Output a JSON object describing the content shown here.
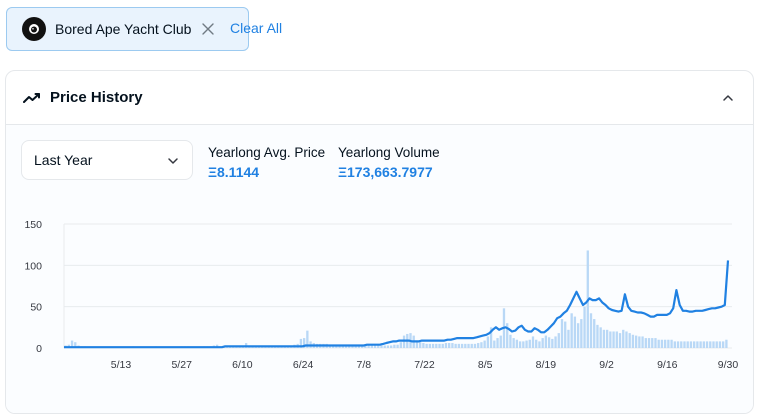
{
  "filter_chip": {
    "label": "Bored Ape Yacht Club",
    "avatar_icon": "ape-logo-icon",
    "close_icon": "close-icon"
  },
  "clear_all_label": "Clear All",
  "panel": {
    "title": "Price History",
    "title_icon": "trending-line-icon",
    "toggle_icon": "chevron-up-icon"
  },
  "range_select": {
    "value": "Last Year",
    "icon": "chevron-down-icon"
  },
  "stats": {
    "avg_price": {
      "label": "Yearlong Avg. Price",
      "value": "Ξ8.1144"
    },
    "volume": {
      "label": "Yearlong Volume",
      "value": "Ξ173,663.7977"
    }
  },
  "colors": {
    "accent": "#2081e2",
    "bar": "#b9d8f6",
    "line": "#2081e2",
    "grid": "#e8ebee"
  },
  "chart_data": {
    "type": "bar+line",
    "ylim": [
      0,
      150
    ],
    "yticks": [
      "150",
      "100",
      "50",
      "0"
    ],
    "xtick_labels": [
      "5/13",
      "5/27",
      "6/10",
      "6/24",
      "7/8",
      "7/22",
      "8/5",
      "8/19",
      "9/2",
      "9/16",
      "9/30"
    ],
    "grid": true,
    "series": [
      {
        "kind": "bar",
        "values": [
          3,
          4,
          9,
          7,
          3,
          2,
          2,
          1,
          1,
          1,
          1,
          1,
          1,
          1,
          1,
          1,
          1,
          1,
          1,
          1,
          1,
          2,
          1,
          1,
          1,
          1,
          1,
          1,
          2,
          1,
          1,
          1,
          1,
          1,
          1,
          1,
          2,
          2,
          2,
          1,
          1,
          1,
          1,
          2,
          2,
          2,
          3,
          4,
          2,
          2,
          2,
          2,
          2,
          2,
          2,
          2,
          6,
          3,
          2,
          2,
          2,
          2,
          2,
          3,
          3,
          3,
          3,
          3,
          3,
          3,
          3,
          4,
          5,
          11,
          12,
          21,
          8,
          6,
          5,
          5,
          5,
          5,
          4,
          3,
          4,
          3,
          3,
          3,
          3,
          3,
          3,
          3,
          3,
          3,
          4,
          3,
          3,
          3,
          3,
          3,
          3,
          3,
          4,
          4,
          7,
          15,
          17,
          18,
          15,
          8,
          7,
          6,
          5,
          5,
          5,
          5,
          5,
          5,
          6,
          6,
          6,
          5,
          5,
          5,
          5,
          5,
          5,
          5,
          6,
          7,
          9,
          14,
          25,
          9,
          12,
          15,
          48,
          30,
          16,
          12,
          10,
          8,
          8,
          9,
          10,
          14,
          10,
          8,
          12,
          15,
          13,
          11,
          14,
          18,
          35,
          32,
          22,
          42,
          38,
          30,
          35,
          50,
          118,
          42,
          35,
          28,
          25,
          22,
          22,
          20,
          20,
          20,
          18,
          22,
          20,
          18,
          16,
          15,
          14,
          14,
          12,
          12,
          12,
          12,
          10,
          10,
          10,
          10,
          10,
          8,
          8,
          8,
          8,
          8,
          8,
          8,
          8,
          8,
          8,
          8,
          8,
          8,
          8,
          8,
          8,
          10
        ]
      },
      {
        "kind": "line",
        "values": [
          1,
          1,
          1,
          1,
          1,
          1,
          1,
          1,
          1,
          1,
          1,
          1,
          1,
          1,
          1,
          1,
          1,
          1,
          1,
          1,
          1,
          1,
          1,
          1,
          1,
          1,
          1,
          1,
          1,
          1,
          1,
          1,
          1,
          1,
          1,
          1,
          1,
          1,
          1,
          1,
          1,
          1,
          1,
          1,
          1,
          1,
          1,
          1,
          1,
          1,
          2,
          2,
          2,
          2,
          2,
          2,
          2,
          2,
          2,
          2,
          2,
          2,
          2,
          2,
          2,
          2,
          2,
          2,
          2,
          2,
          2,
          2,
          2,
          2,
          2,
          3,
          3,
          3,
          3,
          3,
          3,
          3,
          3,
          3,
          3,
          3,
          3,
          3,
          3,
          3,
          3,
          3,
          3,
          3,
          4,
          4,
          4,
          4,
          4,
          5,
          6,
          7,
          8,
          8,
          9,
          9,
          9,
          9,
          8,
          8,
          8,
          9,
          9,
          9,
          9,
          9,
          9,
          9,
          9,
          10,
          10,
          11,
          12,
          12,
          12,
          12,
          12,
          12,
          13,
          14,
          15,
          16,
          18,
          22,
          25,
          22,
          24,
          25,
          23,
          20,
          21,
          25,
          27,
          22,
          20,
          20,
          24,
          22,
          19,
          19,
          22,
          26,
          30,
          36,
          38,
          42,
          45,
          52,
          60,
          68,
          60,
          52,
          55,
          60,
          58,
          58,
          60,
          55,
          52,
          48,
          46,
          45,
          44,
          45,
          65,
          50,
          45,
          44,
          43,
          43,
          42,
          40,
          38,
          38,
          40,
          40,
          40,
          40,
          42,
          48,
          70,
          52,
          45,
          45,
          44,
          44,
          45,
          45,
          45,
          46,
          47,
          48,
          48,
          49,
          50,
          52,
          106
        ]
      }
    ]
  }
}
